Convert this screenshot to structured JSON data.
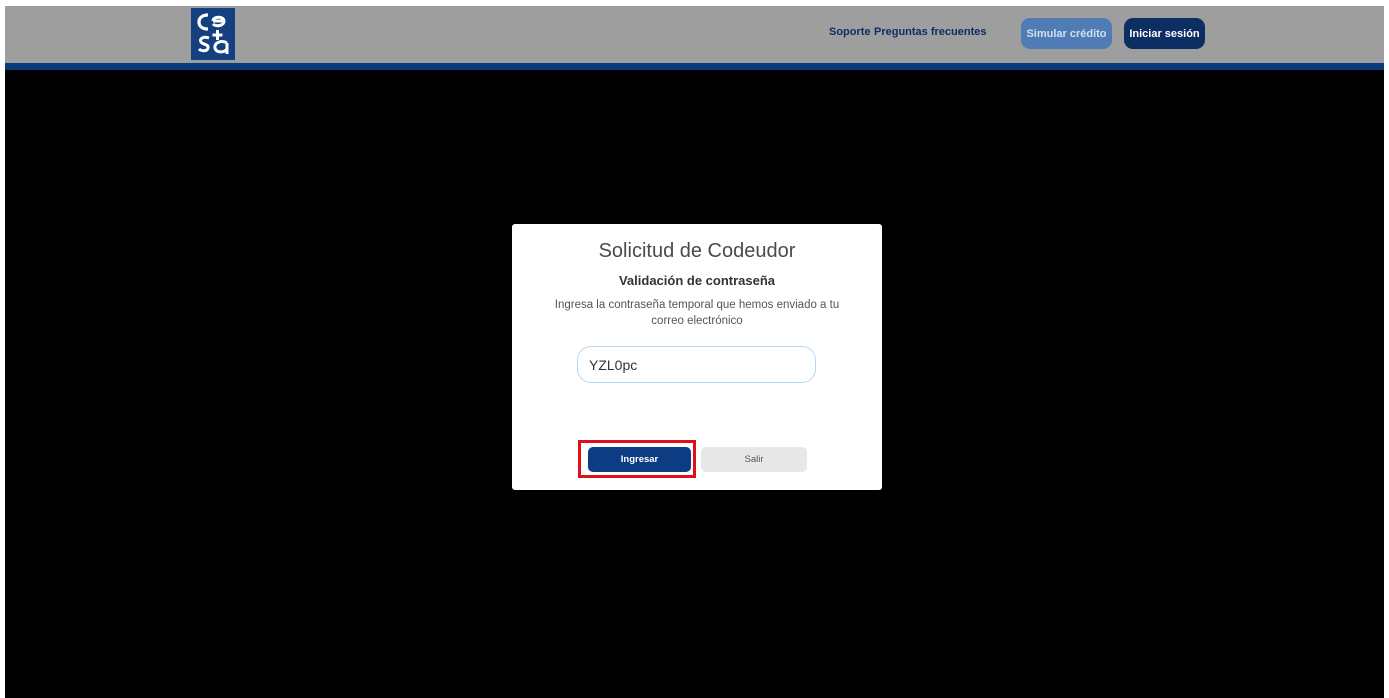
{
  "header": {
    "logo_text": "cesa",
    "nav": {
      "soporte": "Soporte",
      "faq": "Preguntas frecuentes"
    },
    "simular_label": "Simular crédito",
    "login_label": "Iniciar sesión"
  },
  "modal": {
    "title": "Solicitud de Codeudor",
    "subtitle": "Validación de contraseña",
    "description": "Ingresa la contraseña temporal que hemos enviado a tu correo electrónico",
    "password_value": "YZL0pc",
    "submit_label": "Ingresar",
    "exit_label": "Salir"
  },
  "colors": {
    "header_bg": "#9e9e9e",
    "brand_navy": "#0d2e63",
    "header_border": "#0a3a7a",
    "highlight": "#e0101b",
    "simular_bg": "#4f7cb5"
  },
  "icons": {
    "logo": "cesa-logo"
  }
}
